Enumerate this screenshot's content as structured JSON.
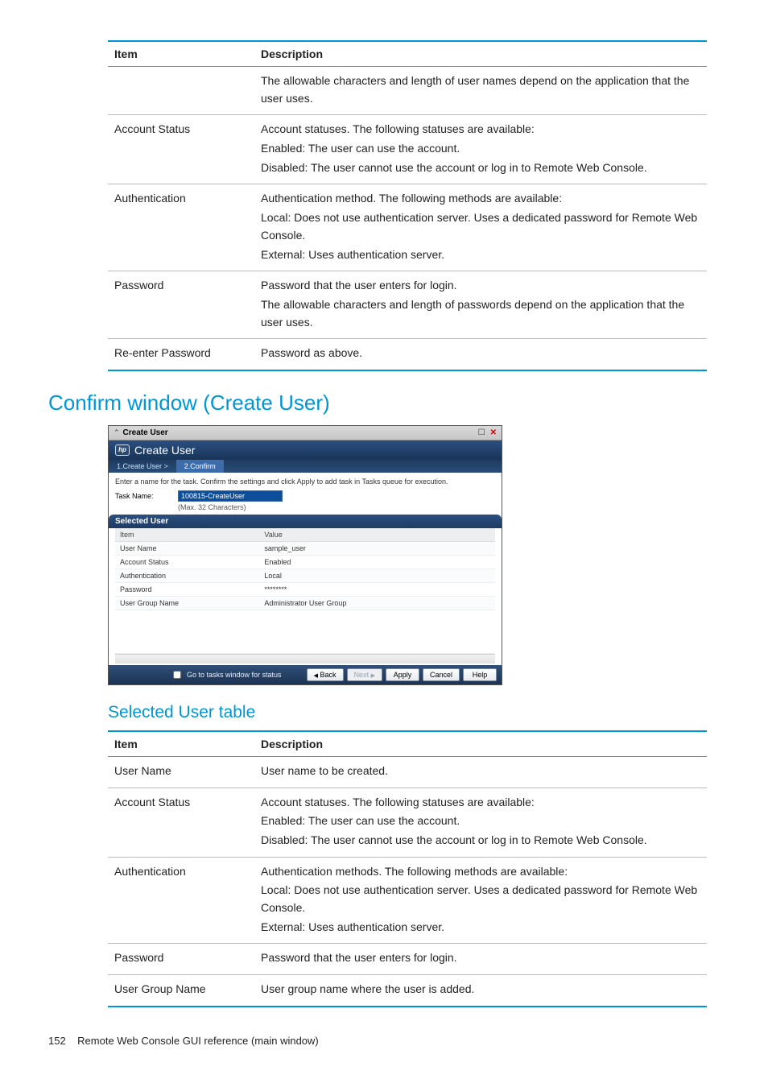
{
  "table1": {
    "headers": {
      "item": "Item",
      "desc": "Description"
    },
    "rows": [
      {
        "item": "",
        "desc": [
          "The allowable characters and length of user names depend on the application that the user uses."
        ]
      },
      {
        "item": "Account Status",
        "desc": [
          "Account statuses. The following statuses are available:",
          "Enabled: The user can use the account.",
          "Disabled: The user cannot use the account or log in to Remote Web Console."
        ]
      },
      {
        "item": "Authentication",
        "desc": [
          "Authentication method. The following methods are available:",
          "Local: Does not use authentication server. Uses a dedicated password for Remote Web Console.",
          "External: Uses authentication server."
        ]
      },
      {
        "item": "Password",
        "desc": [
          "Password that the user enters for login.",
          "The allowable characters and length of passwords depend on the application that the user uses."
        ]
      },
      {
        "item": "Re-enter Password",
        "desc": [
          "Password as above."
        ]
      }
    ]
  },
  "heading_confirm": "Confirm window (Create User)",
  "dialog": {
    "titlebar_title": "Create User",
    "brand_badge": "hp",
    "brand_title": "Create User",
    "steps": {
      "one": "1.Create User >",
      "two": "2.Confirm"
    },
    "instruction": "Enter a name for the task. Confirm the settings and click Apply to add task in Tasks queue for execution.",
    "task_name_label": "Task Name:",
    "task_name_value": "100815-CreateUser",
    "task_name_hint": "(Max. 32 Characters)",
    "selected_user_hdr": "Selected User",
    "selected_user_cols": {
      "item": "Item",
      "value": "Value"
    },
    "selected_user_rows": [
      {
        "k": "User Name",
        "v": "sample_user"
      },
      {
        "k": "Account Status",
        "v": "Enabled"
      },
      {
        "k": "Authentication",
        "v": "Local"
      },
      {
        "k": "Password",
        "v": "********"
      },
      {
        "k": "User Group Name",
        "v": "Administrator User Group"
      }
    ],
    "footer_checkbox_label": "Go to tasks window for status",
    "buttons": {
      "back": "Back",
      "next": "Next",
      "apply": "Apply",
      "cancel": "Cancel",
      "help": "Help"
    }
  },
  "heading_selected_table": "Selected User table",
  "table2": {
    "headers": {
      "item": "Item",
      "desc": "Description"
    },
    "rows": [
      {
        "item": "User Name",
        "desc": [
          "User name to be created."
        ]
      },
      {
        "item": "Account Status",
        "desc": [
          "Account statuses. The following statuses are available:",
          "Enabled: The user can use the account.",
          "Disabled: The user cannot use the account or log in to Remote Web Console."
        ]
      },
      {
        "item": "Authentication",
        "desc": [
          "Authentication methods. The following methods are available:",
          "Local: Does not use authentication server. Uses a dedicated password for Remote Web Console.",
          "External: Uses authentication server."
        ]
      },
      {
        "item": "Password",
        "desc": [
          "Password that the user enters for login."
        ]
      },
      {
        "item": "User Group Name",
        "desc": [
          "User group name where the user is added."
        ]
      }
    ]
  },
  "footer": {
    "page_number": "152",
    "footer_text": "Remote Web Console GUI reference (main window)"
  }
}
